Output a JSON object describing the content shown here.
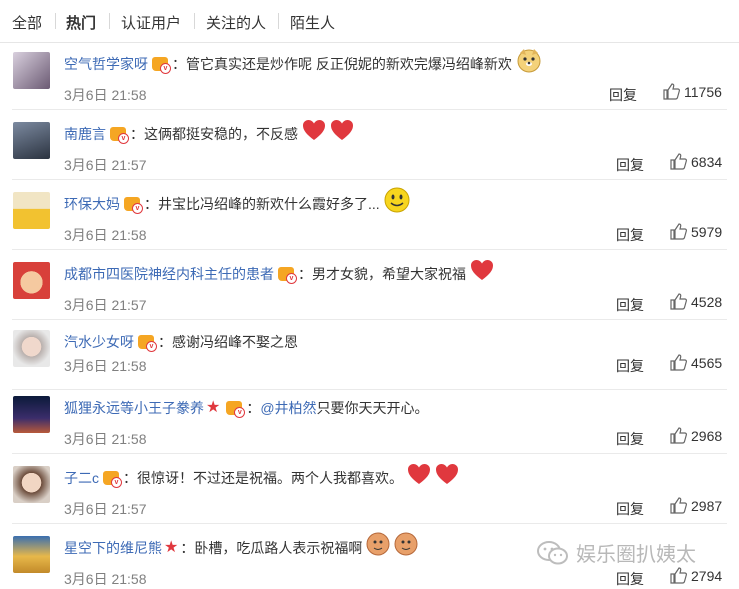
{
  "tabs": [
    {
      "label": "全部"
    },
    {
      "label": "热门"
    },
    {
      "label": "认证用户"
    },
    {
      "label": "关注的人"
    },
    {
      "label": "陌生人"
    }
  ],
  "reply_label": "回复",
  "comments": [
    {
      "user": "空气哲学家呀",
      "colon": "：",
      "text": "管它真实还是炒作呢  反正倪妮的新欢完爆冯绍峰新欢",
      "time": "3月6日 21:58",
      "likes": "11756"
    },
    {
      "user": "南鹿言",
      "colon": "：",
      "text": "这俩都挺安稳的，不反感",
      "time": "3月6日 21:57",
      "likes": "6834"
    },
    {
      "user": "环保大妈",
      "colon": "：",
      "text": "井宝比冯绍峰的新欢什么霞好多了...",
      "time": "3月6日 21:58",
      "likes": "5979"
    },
    {
      "user": "成都市四医院神经内科主任的患者",
      "colon": "：",
      "text": "男才女貌，希望大家祝福",
      "time": "3月6日 21:57",
      "likes": "4528"
    },
    {
      "user": "汽水少女呀",
      "colon": "：",
      "text": "感谢冯绍峰不娶之恩",
      "time": "3月6日 21:58",
      "likes": "4565"
    },
    {
      "user": "狐狸永远等小王子豢养",
      "colon": "：",
      "mention": "@井柏然",
      "text": " 只要你天天开心。",
      "time": "3月6日 21:58",
      "likes": "2968"
    },
    {
      "user": "子二c",
      "colon": "：",
      "text": "很惊讶！不过还是祝福。两个人我都喜欢。",
      "time": "3月6日 21:57",
      "likes": "2987"
    },
    {
      "user": "星空下的维尼熊",
      "colon": "：",
      "text": "卧槽，吃瓜路人表示祝福啊",
      "time": "3月6日 21:58",
      "likes": "2794"
    }
  ],
  "watermark": "娱乐圈扒姨太",
  "colors": {
    "link": "#3d6ab5",
    "time": "#808080",
    "heart": "#e0383e",
    "badge": "#f5a623"
  }
}
